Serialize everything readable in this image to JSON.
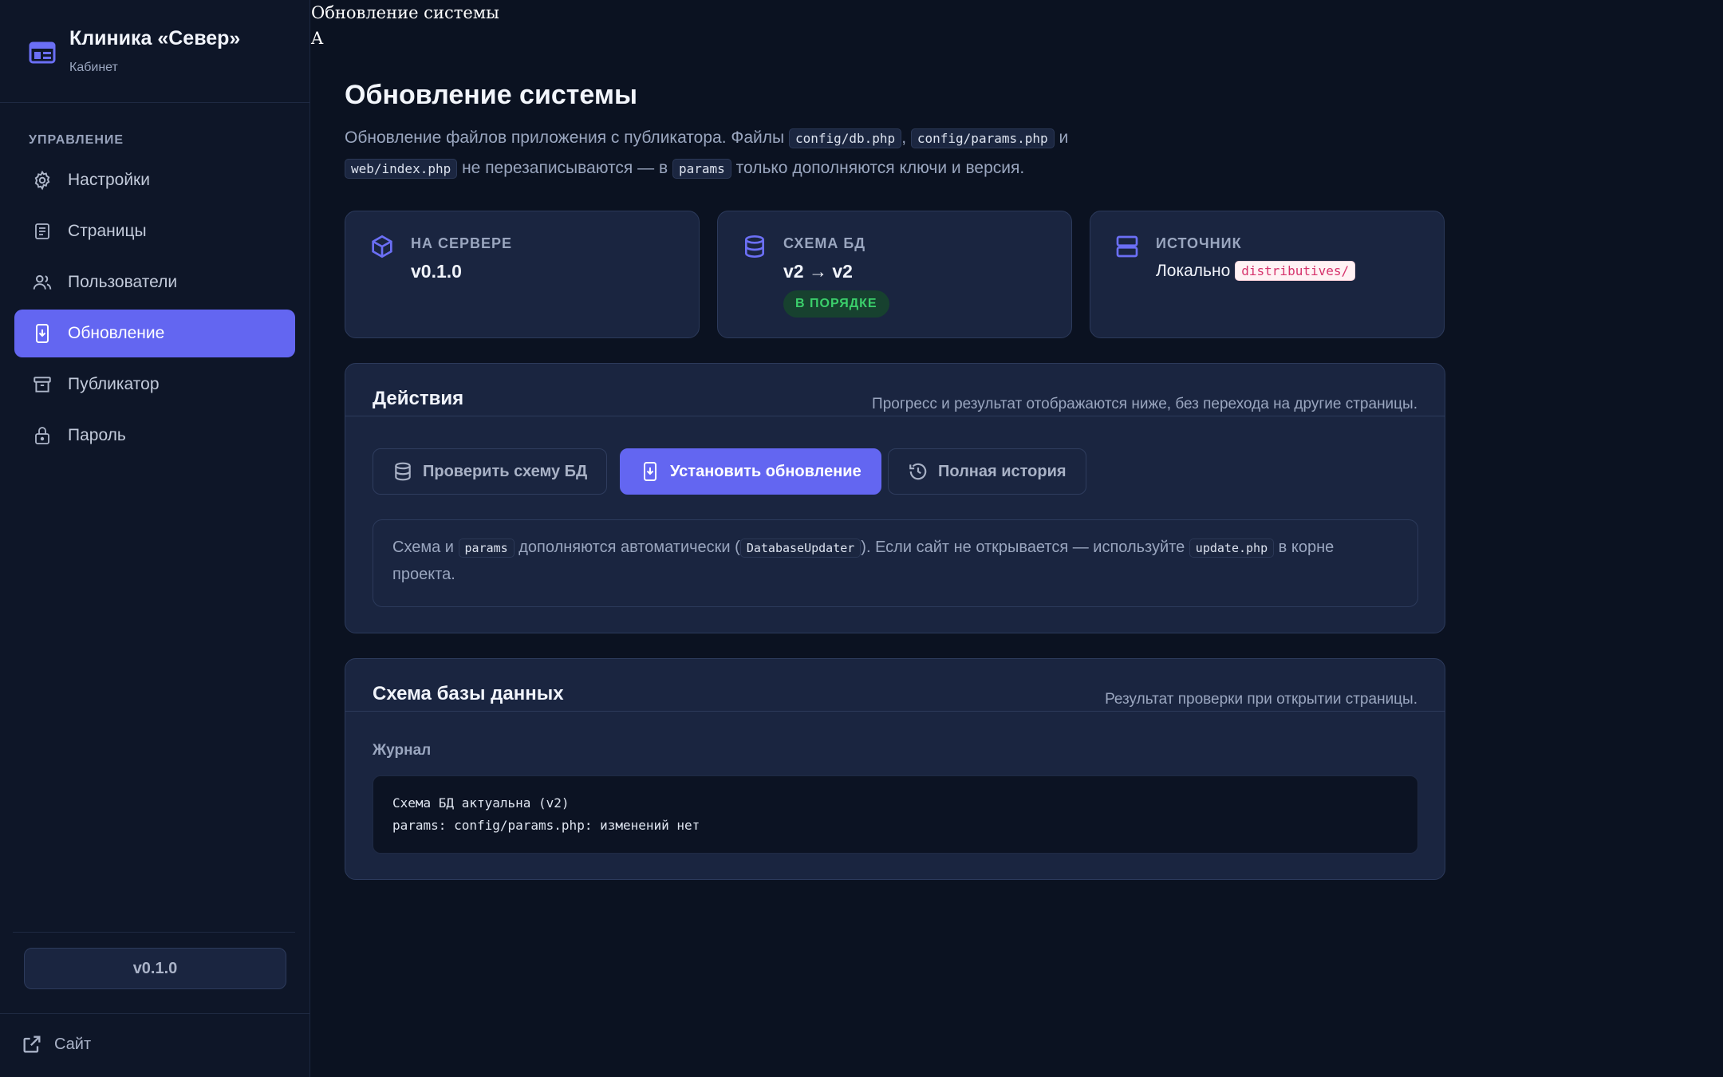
{
  "raw": {
    "title": "Обновление системы",
    "letter": "A"
  },
  "brand": {
    "title": "Клиника «Север»",
    "subtitle": "Кабинет"
  },
  "sidebar": {
    "section_label": "УПРАВЛЕНИЕ",
    "items": [
      {
        "label": "Настройки",
        "icon": "gear-icon"
      },
      {
        "label": "Страницы",
        "icon": "document-icon"
      },
      {
        "label": "Пользователи",
        "icon": "users-icon"
      },
      {
        "label": "Обновление",
        "icon": "phone-download-icon",
        "active": true
      },
      {
        "label": "Публикатор",
        "icon": "archive-icon"
      },
      {
        "label": "Пароль",
        "icon": "lock-icon"
      }
    ],
    "version": "v0.1.0",
    "site_link": "Сайт"
  },
  "page": {
    "title": "Обновление системы",
    "desc_1": "Обновление файлов приложения с публикатора. Файлы",
    "code_1": "config/db.php",
    "sep_1": ",",
    "code_2": "config/params.php",
    "desc_2": "и",
    "code_3": "web/index.php",
    "desc_3": "не перезаписываются — в",
    "code_4": "params",
    "desc_4": "только дополняются ключи и версия."
  },
  "stats": {
    "server": {
      "label": "НА СЕРВЕРЕ",
      "value": "v0.1.0"
    },
    "schema": {
      "label": "СХЕМА БД",
      "value": "v2 → v2",
      "badge": "В ПОРЯДКЕ"
    },
    "source": {
      "label": "ИСТОЧНИК",
      "value": "Локально",
      "code": "distributives/"
    }
  },
  "actions": {
    "title": "Действия",
    "note": "Прогресс и результат отображаются ниже, без перехода на другие страницы.",
    "buttons": {
      "check": "Проверить схему БД",
      "install": "Установить обновление",
      "history": "Полная история"
    },
    "info": {
      "t1": "Схема и",
      "c1": "params",
      "t2": "дополняются автоматически (",
      "c2": "DatabaseUpdater",
      "t3": "). Если сайт не открывается — используйте",
      "c3": "update.php",
      "t4": "в корне проекта."
    }
  },
  "schema_card": {
    "title": "Схема базы данных",
    "note": "Результат проверки при открытии страницы.",
    "log_label": "Журнал",
    "log_lines": [
      "Схема БД актуальна (v2)",
      "params: config/params.php: изменений нет"
    ]
  },
  "colors": {
    "accent": "#6366f1",
    "ok": "#3bcf6b",
    "bg": "#0b1221",
    "card": "#1a2540"
  }
}
